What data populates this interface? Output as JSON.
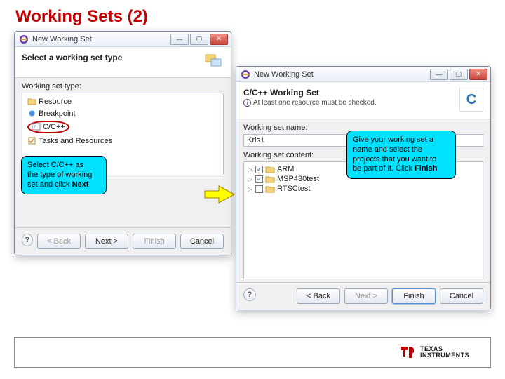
{
  "slide": {
    "title": "Working Sets (2)"
  },
  "dialog1": {
    "window_title": "New Working Set",
    "banner_title": "Select a working set type",
    "section_label": "Working set type:",
    "types": [
      {
        "label": "Resource"
      },
      {
        "label": "Breakpoint"
      },
      {
        "label": "C/C++"
      },
      {
        "label": "Tasks and Resources"
      }
    ],
    "buttons": {
      "back": "< Back",
      "next": "Next >",
      "finish": "Finish",
      "cancel": "Cancel"
    }
  },
  "dialog2": {
    "window_title": "New Working Set",
    "banner_title": "C/C++ Working Set",
    "banner_sub": "At least one resource must be checked.",
    "banner_icon_letter": "C",
    "name_label": "Working set name:",
    "name_value": "Kris1",
    "content_label": "Working set content:",
    "tree": [
      {
        "label": "ARM",
        "checked": true
      },
      {
        "label": "MSP430test",
        "checked": true
      },
      {
        "label": "RTSCtest",
        "checked": false
      }
    ],
    "buttons": {
      "back": "< Back",
      "next": "Next >",
      "finish": "Finish",
      "cancel": "Cancel"
    }
  },
  "callout1": {
    "line1": "Select C/C++ as",
    "line2": "the type of working",
    "line3_prefix": "set and click ",
    "line3_bold": "Next"
  },
  "callout2": {
    "line1": "Give your working set a",
    "line2": "name and select the",
    "line3": "projects that you want to",
    "line4_prefix": "be part of it.  Click ",
    "line4_bold": "Finish"
  },
  "footer": {
    "brand_line1": "TEXAS",
    "brand_line2": "INSTRUMENTS"
  }
}
